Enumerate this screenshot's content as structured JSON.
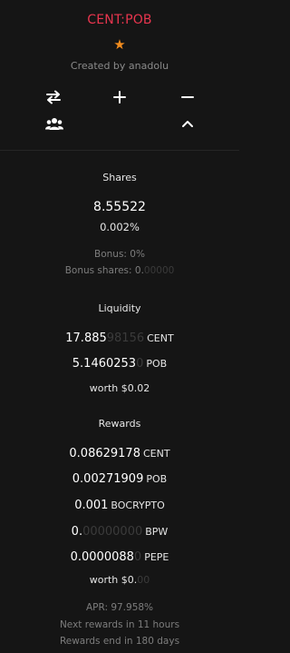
{
  "header": {
    "title": "CENT:POB",
    "star_icon": "star-icon",
    "created_by": "Created by anadolu",
    "actions": [
      {
        "name": "swap-button",
        "icon": "swap-arrows-icon"
      },
      {
        "name": "add-liquidity-button",
        "icon": "plus-icon"
      },
      {
        "name": "remove-liquidity-button",
        "icon": "minus-icon"
      },
      {
        "name": "holders-button",
        "icon": "users-group-icon"
      },
      {
        "name": "collapse-button",
        "icon": "chevron-up-icon"
      }
    ]
  },
  "shares": {
    "title": "Shares",
    "amount": "8.55522",
    "percent": "0.002%",
    "bonus": "Bonus: 0%",
    "bonus_shares_prefix": "Bonus shares: 0.",
    "bonus_shares_dim": "00000"
  },
  "liquidity": {
    "title": "Liquidity",
    "rows": [
      {
        "bright": "17.885",
        "dim": "98156",
        "symbol": "CENT"
      },
      {
        "bright": "5.1460253",
        "dim": "0",
        "symbol": "POB"
      }
    ],
    "worth": "worth $0.02"
  },
  "rewards": {
    "title": "Rewards",
    "rows": [
      {
        "bright": "0.08629178",
        "dim": "",
        "symbol": "CENT"
      },
      {
        "bright": "0.00271909",
        "dim": "",
        "symbol": "POB"
      },
      {
        "bright": "0.001",
        "dim": "",
        "symbol": "BOCRYPTO"
      },
      {
        "bright": "0.",
        "dim": "00000000",
        "symbol": "BPW"
      },
      {
        "bright": "0.0000088",
        "dim": "0",
        "symbol": "PEPE"
      }
    ],
    "worth_prefix": "worth $0.",
    "worth_dim": "00"
  },
  "footer": {
    "apr": "APR: 97.958%",
    "next_rewards": "Next rewards in 11 hours",
    "rewards_end": "Rewards end in 180 days"
  },
  "colors": {
    "title": "#e8354e",
    "star": "#f28c1e",
    "background": "#151515"
  }
}
